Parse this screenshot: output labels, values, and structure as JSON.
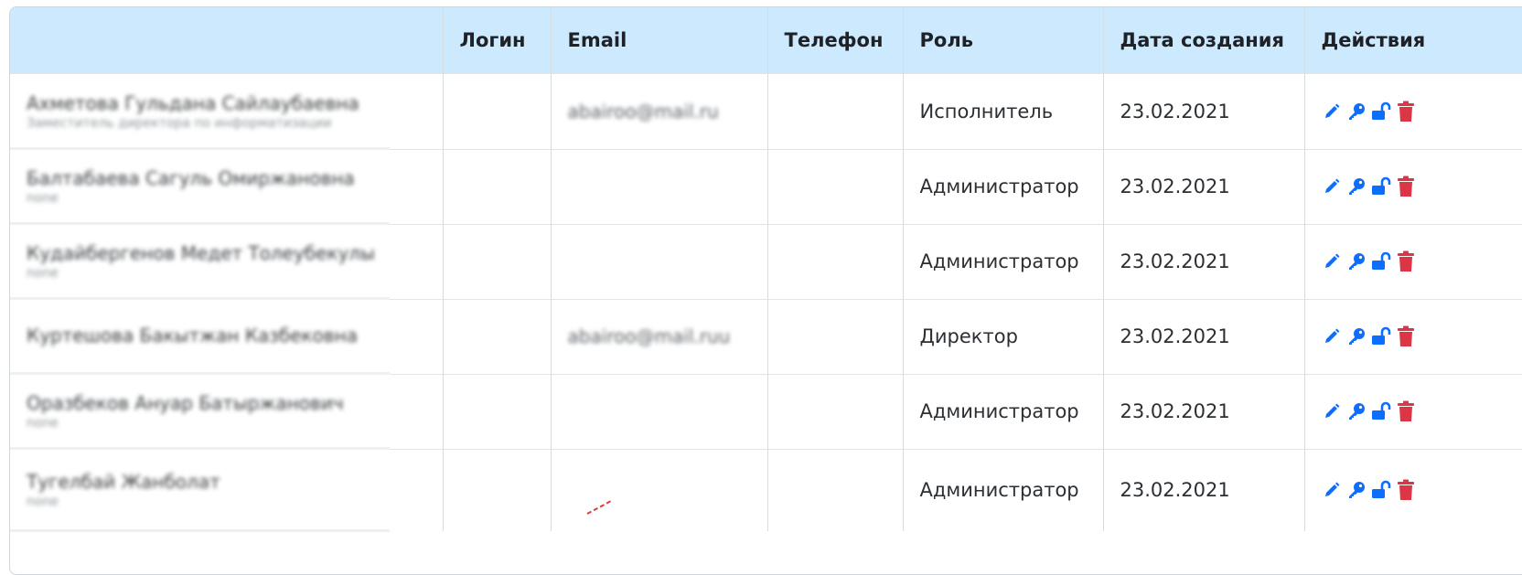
{
  "table": {
    "headers": [
      "",
      "Логин",
      "Email",
      "Телефон",
      "Роль",
      "Дата создания",
      "Действия"
    ],
    "rows": [
      {
        "name": "Ахметова Гульдана Сайлаубаевна",
        "subtitle": "Заместитель директора по информатизации",
        "login": "",
        "email": "abairoo@mail.ru",
        "phone": "",
        "role": "Исполнитель",
        "date": "23.02.2021"
      },
      {
        "name": "Балтабаева Сагуль Омиржановна",
        "subtitle": "none",
        "login": "",
        "email": "",
        "phone": "",
        "role": "Администратор",
        "date": "23.02.2021"
      },
      {
        "name": "Кудайбергенов Медет Толеубекулы",
        "subtitle": "none",
        "login": "",
        "email": "",
        "phone": "",
        "role": "Администратор",
        "date": "23.02.2021"
      },
      {
        "name": "Куртешова Бакытжан Казбековна",
        "subtitle": "",
        "login": "",
        "email": "abairoo@mail.ruu",
        "phone": "",
        "role": "Директор",
        "date": "23.02.2021"
      },
      {
        "name": "Оразбеков Ануар Батыржанович",
        "subtitle": "none",
        "login": "",
        "email": "",
        "phone": "",
        "role": "Администратор",
        "date": "23.02.2021"
      },
      {
        "name": "Тугелбай Жанболат",
        "subtitle": "none",
        "login": "",
        "email": "",
        "phone": "",
        "role": "Администратор",
        "date": "23.02.2021"
      }
    ]
  },
  "icons": {
    "edit": "pencil-icon",
    "password": "key-icon",
    "block": "unlock-icon",
    "delete": "trash-icon"
  },
  "colors": {
    "header_bg": "#cce9fd",
    "action_blue": "#0d6efd",
    "action_red": "#dc3545"
  }
}
